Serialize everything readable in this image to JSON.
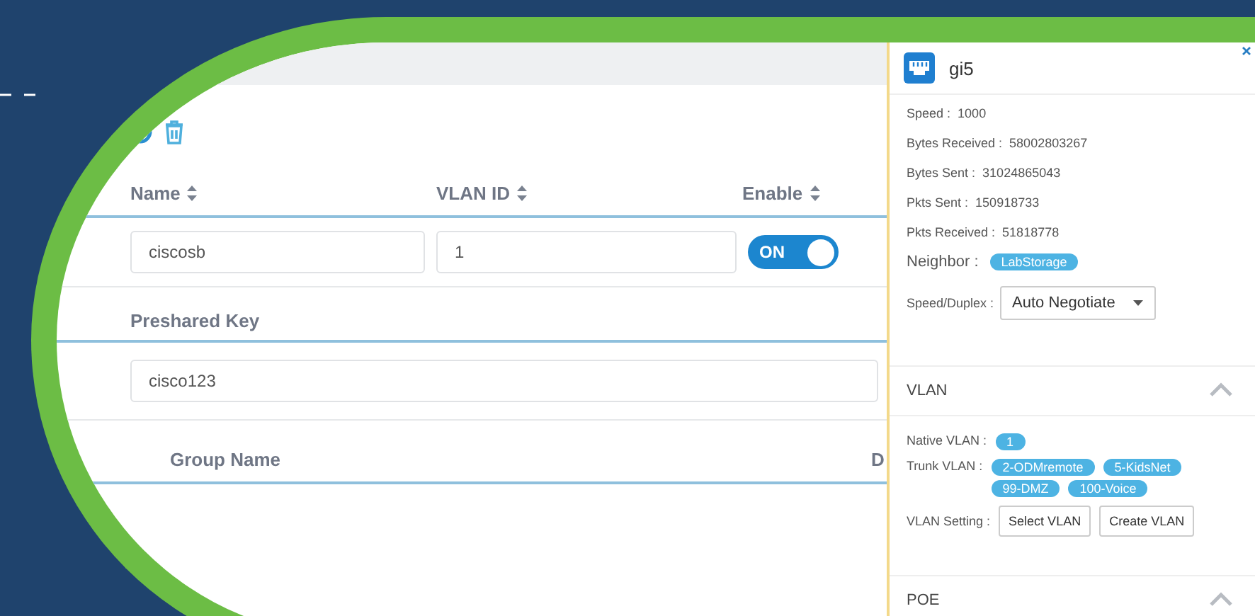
{
  "table": {
    "columns": [
      {
        "label": "Name"
      },
      {
        "label": "VLAN ID"
      },
      {
        "label": "Enable"
      }
    ],
    "row": {
      "name": "ciscosb",
      "vlan_id": "1",
      "enable": true,
      "enable_label": "ON"
    },
    "preshared_key": {
      "label": "Preshared Key",
      "value": "cisco123"
    },
    "group_columns": [
      {
        "label": "Group Name"
      },
      {
        "label": "D"
      }
    ]
  },
  "panel": {
    "title": "gi5",
    "stats": [
      {
        "label": "Speed :",
        "value": "1000"
      },
      {
        "label": "Bytes Received :",
        "value": "58002803267"
      },
      {
        "label": "Bytes Sent :",
        "value": "31024865043"
      },
      {
        "label": "Pkts Sent :",
        "value": "150918733"
      },
      {
        "label": "Pkts Received :",
        "value": "51818778"
      }
    ],
    "neighbor": {
      "label": "Neighbor :",
      "tag": "LabStorage"
    },
    "speed_duplex": {
      "label": "Speed/Duplex :",
      "value": "Auto Negotiate"
    },
    "sections": [
      {
        "title": "VLAN",
        "expanded": true
      },
      {
        "title": "POE",
        "expanded": true
      }
    ],
    "native_vlan": {
      "label": "Native VLAN :",
      "tags": [
        "1"
      ]
    },
    "trunk_vlan": {
      "label": "Trunk VLAN :",
      "tags": [
        "2-ODMremote",
        "5-KidsNet",
        "99-DMZ",
        "100-Voice"
      ]
    },
    "vlan_setting": {
      "label": "VLAN Setting :",
      "buttons": [
        "Select VLAN",
        "Create VLAN"
      ]
    }
  }
}
